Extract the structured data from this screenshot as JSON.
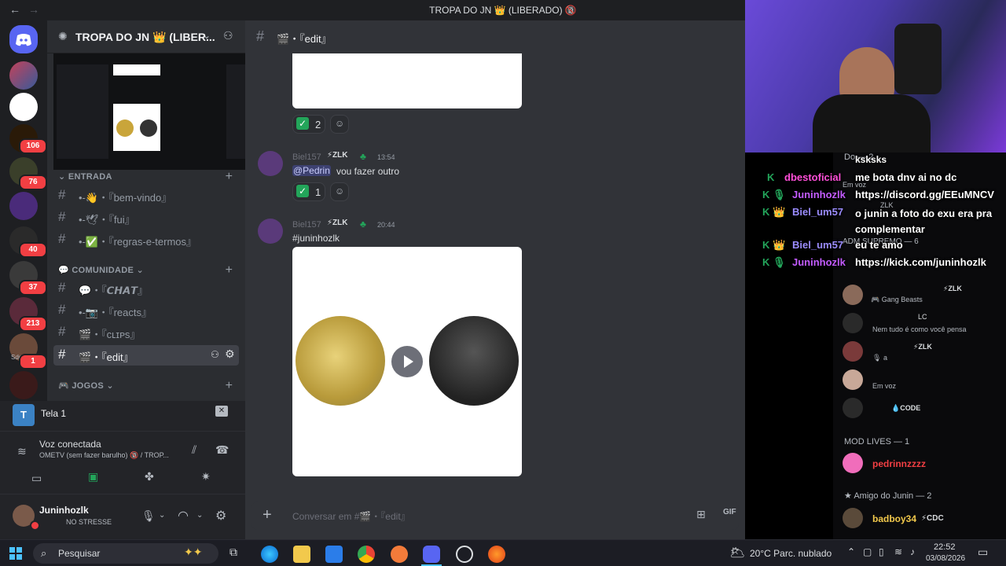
{
  "window": {
    "title": "TROPA DO JN 👑 (LIBERADO) 🔞"
  },
  "server": {
    "name": "TROPA DO JN 👑 (LIBER..."
  },
  "rail_badges": [
    "106",
    "76",
    "40",
    "37",
    "213",
    "1"
  ],
  "rail_labels": {
    "sdo": "Sdo"
  },
  "categories": {
    "entrada": "ENTRADA",
    "comunidade": "COMUNIDADE",
    "jogos": "JOGOS"
  },
  "channels": [
    {
      "label": "•-👋・『bem-vindo』"
    },
    {
      "label": "•-🕊・『fui』"
    },
    {
      "label": "•-✅・『regras-e-termos』"
    },
    {
      "label": "💬・『𝘾𝙃𝘼𝙏』"
    },
    {
      "label": "•-📷・『reacts』"
    },
    {
      "label": "🎬・『ᴄʟɪᴘs』"
    },
    {
      "label": "🎬・『edit』"
    }
  ],
  "stream": {
    "label": "Tela 1"
  },
  "voice": {
    "status": "Voz conectada",
    "detail": "OMETV (sem fazer barulho) 🔞 / TROP..."
  },
  "user": {
    "name": "Juninhozlk",
    "status": "NO STRESSE"
  },
  "channel_header": {
    "name": "🎬・『edit』"
  },
  "messages": [
    {
      "author": "Biel157",
      "tag": "ZLK",
      "time": "13:54",
      "mention": "@Pedrin",
      "text": "vou fazer outro",
      "reaction_count": "1"
    },
    {
      "author": "Biel157",
      "tag": "ZLK",
      "time": "20:44",
      "text": "#juninhozlk"
    }
  ],
  "top_reaction_count": "2",
  "composer": {
    "placeholder": "Conversar em #🎬・『edit』"
  },
  "overlay_chat": [
    {
      "user": "dbestoficial",
      "text": "me bota dnv ai no dc",
      "color": "#ff4fd8"
    },
    {
      "user": "Juninhozlk",
      "text": "https://discord.gg/EEuMNCV",
      "color": "#c35cff"
    },
    {
      "user": "Biel_um57",
      "text": "o junin a foto do exu era pra complementar",
      "color": "#9b8cff"
    },
    {
      "user": "Biel_um57",
      "text": "eu te amo",
      "color": "#9b8cff"
    },
    {
      "user": "Juninhozlk",
      "text": "https://kick.com/juninhozlk",
      "color": "#c35cff"
    }
  ],
  "overlay_top": "ksksks",
  "members": {
    "header_do": "Do",
    "do_count": "2",
    "em_voz": "Em voz",
    "zlk": "ZLK",
    "adm_header": "ADM SUPREMO — 6",
    "gang_beasts": "Gang Beasts",
    "lc": "LC",
    "nem_tudo": "Nem tudo é como você pensa",
    "a": "a",
    "code": "CODE",
    "mod_header": "MOD LIVES — 1",
    "mod_user": "pedrinnzzzz",
    "amigo_header": "Amigo do Junin — 2",
    "amigo_user": "badboy34",
    "amigo_tag": "CDC"
  },
  "taskbar": {
    "search": "Pesquisar",
    "weather": "20°C  Parc. nublado",
    "time": "22:52",
    "date": "03/08/2026"
  },
  "colors": {
    "accent": "#5865f2",
    "online": "#23a55a",
    "danger": "#f23f43"
  }
}
